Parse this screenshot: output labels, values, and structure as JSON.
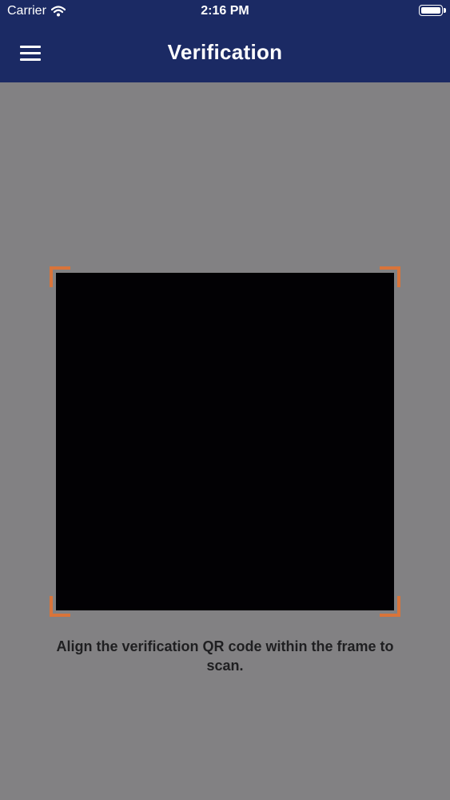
{
  "status_bar": {
    "carrier": "Carrier",
    "time": "2:16 PM",
    "wifi_icon": "wifi-icon",
    "battery_icon": "battery-icon"
  },
  "header": {
    "menu_icon": "hamburger-menu-icon",
    "title": "Verification"
  },
  "scanner": {
    "instruction": "Align the verification QR code within the frame to scan."
  },
  "colors": {
    "header_bg": "#1b2a64",
    "page_bg": "#828183",
    "scanner_bg": "#020104",
    "corner_accent": "#d9743a"
  }
}
